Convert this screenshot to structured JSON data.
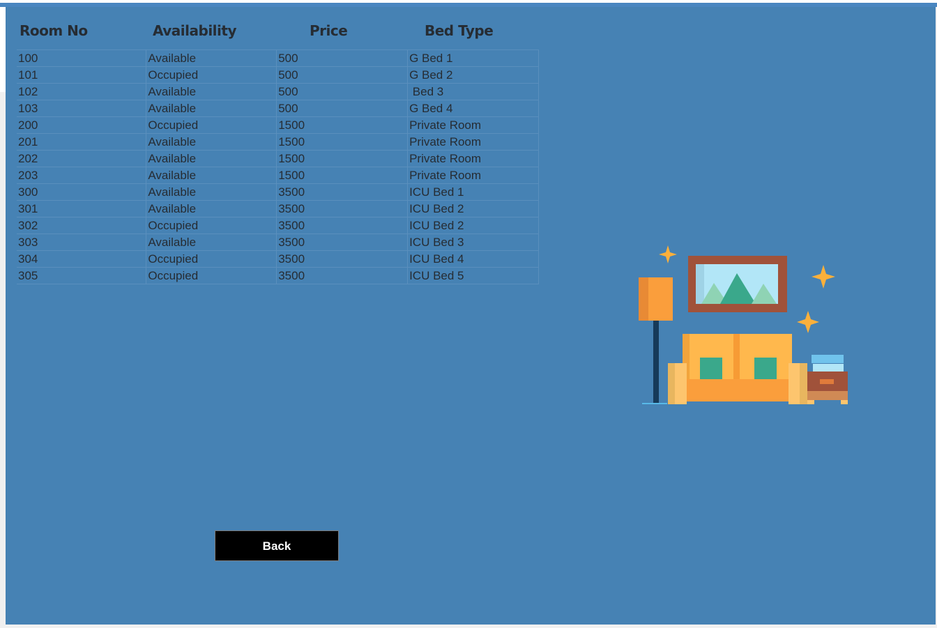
{
  "columns": [
    "Room No",
    "Availability",
    "Price",
    "Bed Type"
  ],
  "rows": [
    {
      "room": "100",
      "availability": "Available",
      "price": "500",
      "bed": "G Bed 1"
    },
    {
      "room": "101",
      "availability": "Occupied",
      "price": "500",
      "bed": "G Bed 2"
    },
    {
      "room": "102",
      "availability": "Available",
      "price": "500",
      "bed": " Bed 3"
    },
    {
      "room": "103",
      "availability": "Available",
      "price": "500",
      "bed": "G Bed 4"
    },
    {
      "room": "200",
      "availability": "Occupied",
      "price": "1500",
      "bed": "Private Room"
    },
    {
      "room": "201",
      "availability": "Available",
      "price": "1500",
      "bed": "Private Room"
    },
    {
      "room": "202",
      "availability": "Available",
      "price": "1500",
      "bed": "Private Room"
    },
    {
      "room": "203",
      "availability": "Available",
      "price": "1500",
      "bed": "Private Room"
    },
    {
      "room": "300",
      "availability": "Available",
      "price": "3500",
      "bed": "ICU Bed 1"
    },
    {
      "room": "301",
      "availability": "Available",
      "price": "3500",
      "bed": "ICU Bed 2"
    },
    {
      "room": "302",
      "availability": "Occupied",
      "price": "3500",
      "bed": "ICU Bed 2"
    },
    {
      "room": "303",
      "availability": "Available",
      "price": "3500",
      "bed": "ICU Bed 3"
    },
    {
      "room": "304",
      "availability": "Occupied",
      "price": "3500",
      "bed": "ICU Bed 4"
    },
    {
      "room": "305",
      "availability": "Occupied",
      "price": "3500",
      "bed": "ICU Bed 5"
    }
  ],
  "back_label": "Back",
  "colors": {
    "panel": "#4682b4",
    "text": "#262c33",
    "button": "#000000"
  },
  "illustration": "room-sofa-illustration"
}
